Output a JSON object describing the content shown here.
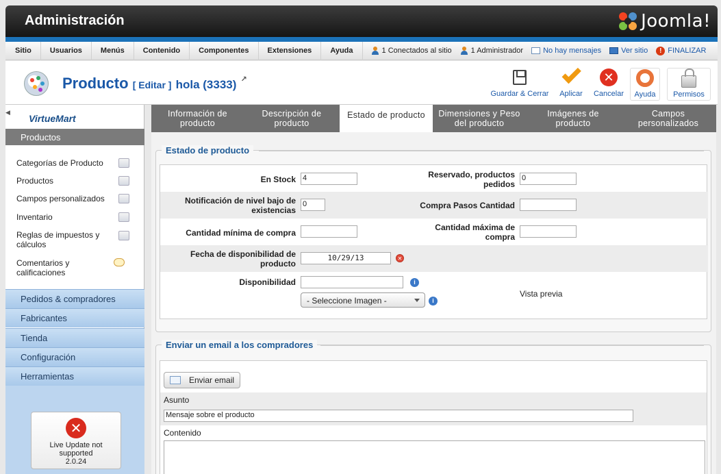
{
  "header": {
    "title": "Administración",
    "logo_text": "Joomla!"
  },
  "menubar": {
    "menus": [
      "Sitio",
      "Usuarios",
      "Menús",
      "Contenido",
      "Componentes",
      "Extensiones",
      "Ayuda"
    ],
    "online": "1 Conectados al sitio",
    "admin": "1 Administrador",
    "messages": "No hay mensajes",
    "view_site": "Ver sitio",
    "logout": "FINALIZAR"
  },
  "toolbar": {
    "title": "Producto",
    "action": "[ Editar ]",
    "product_name": "hola (3333)",
    "save_close": "Guardar & Cerrar",
    "apply": "Aplicar",
    "cancel": "Cancelar",
    "help": "Ayuda",
    "permissions": "Permisos"
  },
  "sidebar": {
    "brand": "VirtueMart",
    "section": "Productos",
    "items": [
      "Categorías de Producto",
      "Productos",
      "Campos personalizados",
      "Inventario",
      "Reglas de impuestos y cálculos",
      "Comentarios y calificaciones"
    ],
    "groups": [
      "Pedidos & compradores",
      "Fabricantes",
      "Tienda",
      "Configuración",
      "Herramientas"
    ],
    "live_update": {
      "line1": "Live Update not",
      "line2": "supported",
      "version": "2.0.24"
    }
  },
  "tabs": [
    {
      "line1": "Información de",
      "line2": "producto"
    },
    {
      "line1": "Descripción de",
      "line2": "producto"
    },
    {
      "line1": "Estado de producto",
      "line2": ""
    },
    {
      "line1": "Dimensiones y Peso",
      "line2": "del producto"
    },
    {
      "line1": "Imágenes de",
      "line2": "producto"
    },
    {
      "line1": "Campos",
      "line2": "personalizados"
    }
  ],
  "status": {
    "legend": "Estado de producto",
    "in_stock": {
      "label": "En Stock",
      "value": "4"
    },
    "reserved": {
      "label1": "Reservado, productos",
      "label2": "pedidos",
      "value": "0"
    },
    "low_stock": {
      "label1": "Notificación de nivel bajo de",
      "label2": "existencias",
      "value": "0"
    },
    "order_steps": {
      "label": "Compra Pasos Cantidad",
      "value": ""
    },
    "min_qty": {
      "label": "Cantidad mínima de compra",
      "value": ""
    },
    "max_qty": {
      "label1": "Cantidad máxima de",
      "label2": "compra",
      "value": ""
    },
    "availability_date": {
      "label1": "Fecha de disponibilidad de",
      "label2": "producto",
      "value": "10/29/13"
    },
    "availability": {
      "label": "Disponibilidad",
      "value": "",
      "select": "- Seleccione Imagen -",
      "preview": "Vista previa"
    }
  },
  "email": {
    "legend": "Enviar un email a los compradores",
    "button": "Enviar email",
    "subject_label": "Asunto",
    "subject_value": "Mensaje sobre el producto",
    "content_label": "Contenido"
  }
}
